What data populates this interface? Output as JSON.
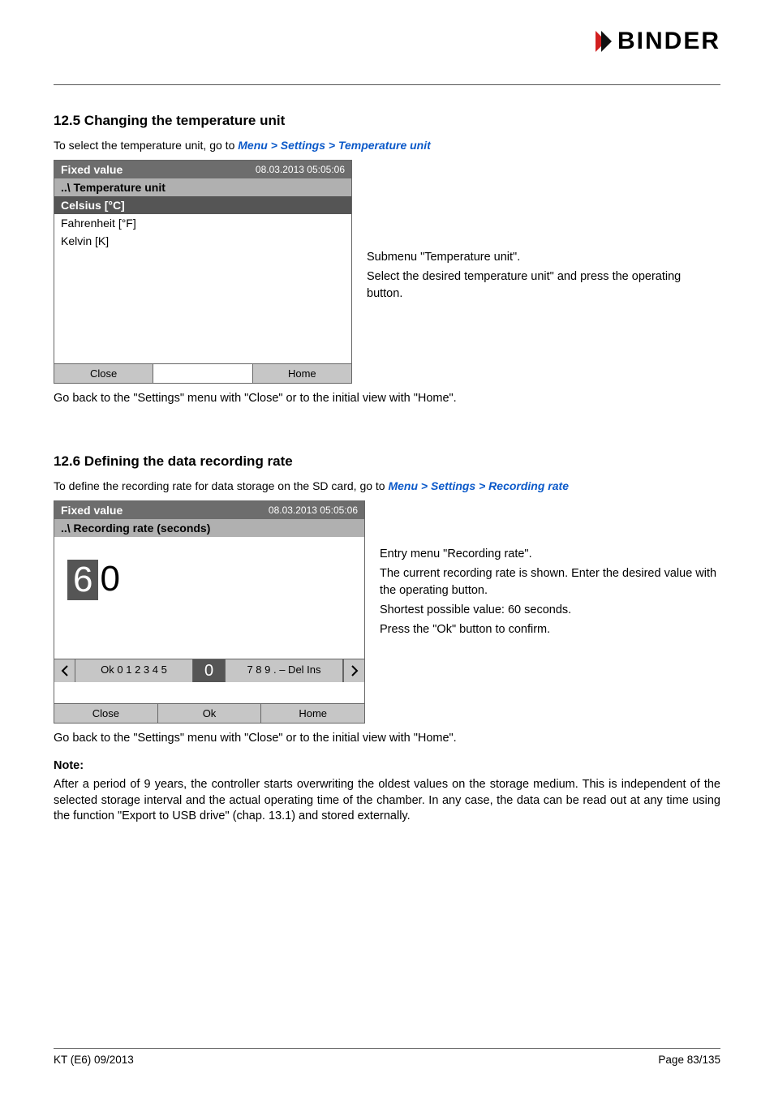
{
  "logo": {
    "text": "BINDER"
  },
  "section1": {
    "heading": "12.5   Changing the temperature unit",
    "lead_prefix": "To select the temperature unit, go to ",
    "lead_path": "Menu > Settings > Temperature unit",
    "after": "Go back to the \"Settings\" menu with \"Close\" or to the initial view with \"Home\"."
  },
  "widget1": {
    "title": "Fixed value",
    "timestamp": "08.03.2013  05:05:06",
    "breadcrumb": "..\\ Temperature unit",
    "selected": "Celsius [°C]",
    "items": [
      "Fahrenheit [°F]",
      "Kelvin [K]"
    ],
    "btn_close": "Close",
    "btn_home": "Home"
  },
  "side1": {
    "l1": "Submenu \"Temperature unit\".",
    "l2": "Select the desired temperature unit\" and press the operating button."
  },
  "section2": {
    "heading": "12.6   Defining the data recording rate",
    "lead_prefix": "To define the recording rate for data storage on the SD card, go to ",
    "lead_path": "Menu > Settings > Recording rate",
    "after": "Go back to the \"Settings\" menu with \"Close\" or to the initial view with \"Home\"."
  },
  "widget2": {
    "title": "Fixed value",
    "timestamp": "08.03.2013  05:05:06",
    "breadcrumb": "..\\ Recording rate (seconds)",
    "digit_hl": "6",
    "digit_rest": "0",
    "row_left": "Ok  0 1 2 3 4 5",
    "row_mid": "0",
    "row_right": "7 8 9 . – Del Ins",
    "btn_close": "Close",
    "btn_ok": "Ok",
    "btn_home": "Home"
  },
  "side2": {
    "l1": "Entry menu \"Recording rate\".",
    "l2": "The current recording rate is shown. Enter the desired value with the operating button.",
    "l3": "Shortest possible value: 60 seconds.",
    "l4": "Press the \"Ok\" button to confirm."
  },
  "note": {
    "h": "Note:",
    "p": "After a period of 9 years, the controller starts overwriting the oldest values on the storage medium. This is independent of the selected storage interval and the actual operating time of the chamber. In any case, the data can be read out at any time using the function \"Export to USB drive\" (chap. 13.1) and stored externally."
  },
  "footer": {
    "left": "KT (E6) 09/2013",
    "right": "Page 83/135"
  }
}
